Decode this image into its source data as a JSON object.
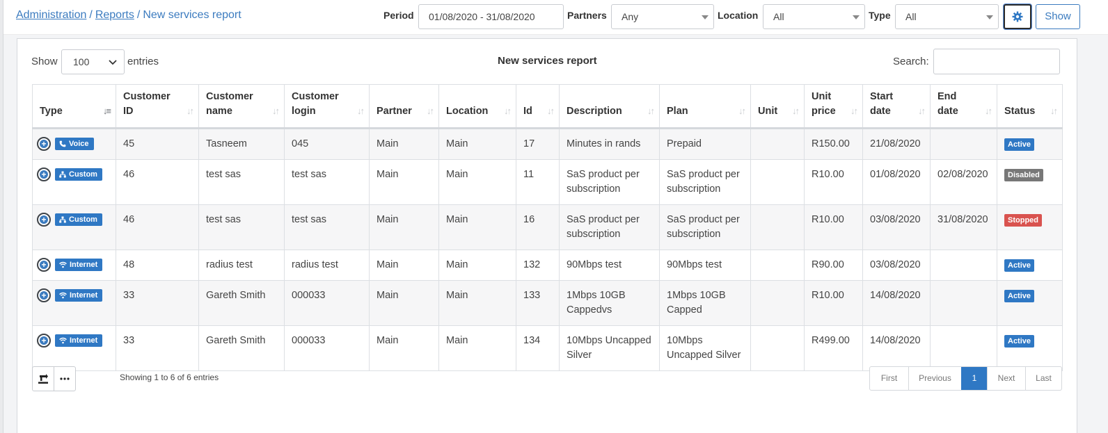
{
  "breadcrumb": {
    "items": [
      "Administration",
      "Reports"
    ],
    "current": "New services report",
    "separator": "/"
  },
  "filters": {
    "period_label": "Period",
    "period_value": "01/08/2020 - 31/08/2020",
    "partners_label": "Partners",
    "partners_value": "Any",
    "location_label": "Location",
    "location_value": "All",
    "type_label": "Type",
    "type_value": "All",
    "settings_icon": "gear-icon",
    "show_label": "Show"
  },
  "table_controls": {
    "show_label": "Show",
    "entries_value": "100",
    "entries_label": "entries",
    "title": "New services report",
    "search_label": "Search:"
  },
  "columns": [
    "Type",
    "Customer ID",
    "Customer name",
    "Customer login",
    "Partner",
    "Location",
    "Id",
    "Description",
    "Plan",
    "Unit",
    "Unit price",
    "Start date",
    "End date",
    "Status"
  ],
  "rows": [
    {
      "type": "Voice",
      "type_icon": "phone-icon",
      "customer_id": "45",
      "customer_name": "Tasneem",
      "customer_login": "045",
      "partner": "Main",
      "location": "Main",
      "id": "17",
      "description": "Minutes in rands",
      "plan": "Prepaid",
      "unit": "",
      "unit_price": "R150.00",
      "start_date": "21/08/2020",
      "end_date": "",
      "status": "Active"
    },
    {
      "type": "Custom",
      "type_icon": "sitemap-icon",
      "customer_id": "46",
      "customer_name": "test sas",
      "customer_login": "test sas",
      "partner": "Main",
      "location": "Main",
      "id": "11",
      "description": "SaS product per subscription",
      "plan": "SaS product per subscription",
      "unit": "",
      "unit_price": "R10.00",
      "start_date": "01/08/2020",
      "end_date": "02/08/2020",
      "status": "Disabled"
    },
    {
      "type": "Custom",
      "type_icon": "sitemap-icon",
      "customer_id": "46",
      "customer_name": "test sas",
      "customer_login": "test sas",
      "partner": "Main",
      "location": "Main",
      "id": "16",
      "description": "SaS product per subscription",
      "plan": "SaS product per subscription",
      "unit": "",
      "unit_price": "R10.00",
      "start_date": "03/08/2020",
      "end_date": "31/08/2020",
      "status": "Stopped"
    },
    {
      "type": "Internet",
      "type_icon": "wifi-icon",
      "customer_id": "48",
      "customer_name": "radius test",
      "customer_login": "radius test",
      "partner": "Main",
      "location": "Main",
      "id": "132",
      "description": "90Mbps test",
      "plan": "90Mbps test",
      "unit": "",
      "unit_price": "R90.00",
      "start_date": "03/08/2020",
      "end_date": "",
      "status": "Active"
    },
    {
      "type": "Internet",
      "type_icon": "wifi-icon",
      "customer_id": "33",
      "customer_name": "Gareth Smith",
      "customer_login": "000033",
      "partner": "Main",
      "location": "Main",
      "id": "133",
      "description": "1Mbps 10GB Cappedvs",
      "plan": "1Mbps 10GB Capped",
      "unit": "",
      "unit_price": "R10.00",
      "start_date": "14/08/2020",
      "end_date": "",
      "status": "Active"
    },
    {
      "type": "Internet",
      "type_icon": "wifi-icon",
      "customer_id": "33",
      "customer_name": "Gareth Smith",
      "customer_login": "000033",
      "partner": "Main",
      "location": "Main",
      "id": "134",
      "description": "10Mbps Uncapped Silver",
      "plan": "10Mbps Uncapped Silver",
      "unit": "",
      "unit_price": "R499.00",
      "start_date": "14/08/2020",
      "end_date": "",
      "status": "Active"
    }
  ],
  "status_colors": {
    "Active": "#2f78c4",
    "Disabled": "#777777",
    "Stopped": "#d9534f"
  },
  "footer": {
    "export_icon": "export-icon",
    "more_icon": "more-dots-icon",
    "info": "Showing 1 to 6 of 6 entries",
    "pager": [
      "First",
      "Previous",
      "1",
      "Next",
      "Last"
    ],
    "current_page": "1"
  }
}
